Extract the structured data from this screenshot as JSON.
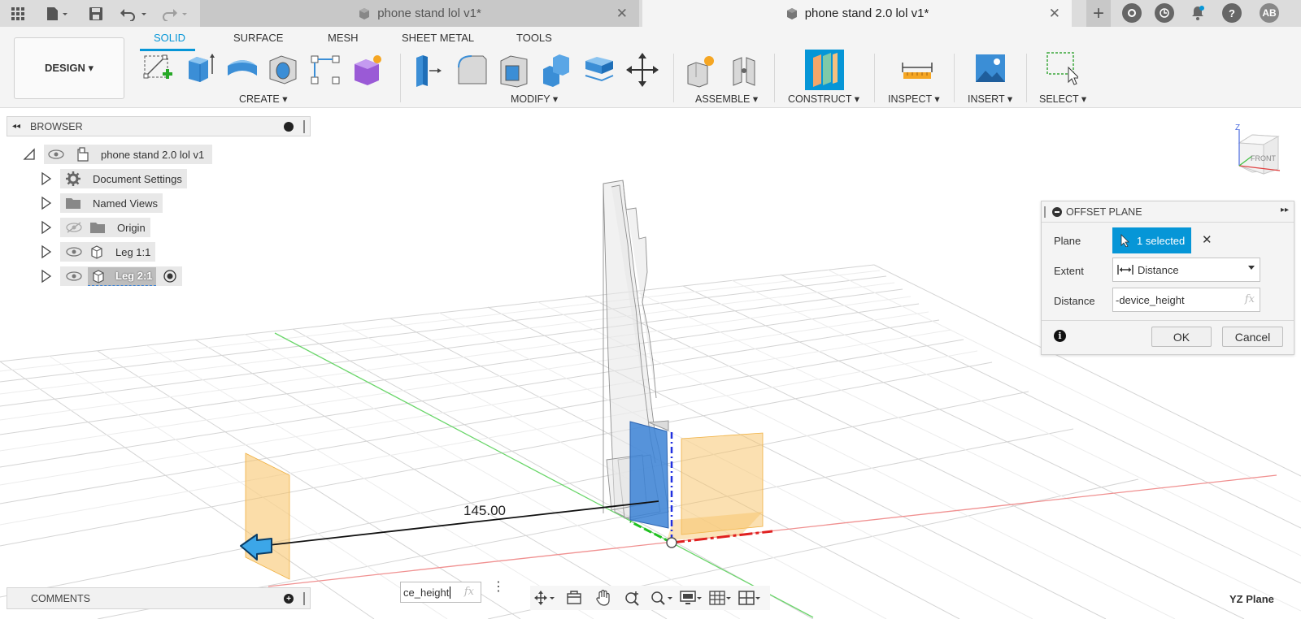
{
  "titlebar": {
    "tabs": [
      {
        "label": "phone stand lol v1*",
        "active": false
      },
      {
        "label": "phone stand 2.0 lol v1*",
        "active": true
      }
    ],
    "close_glyph": "✕",
    "add_glyph": "+",
    "user_initials": "AB",
    "help_glyph": "?"
  },
  "toolbar": {
    "design_label": "DESIGN ▾",
    "workspace_tabs": [
      "SOLID",
      "SURFACE",
      "MESH",
      "SHEET METAL",
      "TOOLS"
    ],
    "active_tab": "SOLID",
    "groups": [
      "CREATE ▾",
      "MODIFY ▾",
      "ASSEMBLE ▾",
      "CONSTRUCT ▾",
      "INSPECT ▾",
      "INSERT ▾",
      "SELECT ▾"
    ]
  },
  "browser": {
    "title": "BROWSER",
    "collapse_glyph": "◂◂",
    "root": "phone stand 2.0 lol v1",
    "items": [
      {
        "label": "Document Settings",
        "icon": "gear-icon"
      },
      {
        "label": "Named Views",
        "icon": "folder-icon"
      },
      {
        "label": "Origin",
        "icon": "folder-icon",
        "hidden": true
      },
      {
        "label": "Leg 1:1",
        "icon": "component-icon"
      },
      {
        "label": "Leg 2:1",
        "icon": "component-icon",
        "selected": true
      }
    ]
  },
  "viewport": {
    "dimension_value": "145.00",
    "viewcube_face": "FRONT",
    "viewcube_axis": "Z",
    "plane_label": "YZ Plane",
    "accent_blue": "#0696d7",
    "plane_orange": "#f7c163",
    "x_axis_color": "#e02020",
    "y_axis_color": "#20c020",
    "z_axis_color": "#2030e0"
  },
  "dialog": {
    "title": "OFFSET PLANE",
    "plane_label": "Plane",
    "plane_value": "1 selected",
    "extent_label": "Extent",
    "extent_value": "Distance",
    "distance_label": "Distance",
    "distance_value": "-device_height",
    "fx_glyph": "fx",
    "ok_label": "OK",
    "cancel_label": "Cancel",
    "info_glyph": "i"
  },
  "comments": {
    "title": "COMMENTS"
  },
  "expression_input": {
    "value": "ce_height",
    "fx_glyph": "fx"
  }
}
